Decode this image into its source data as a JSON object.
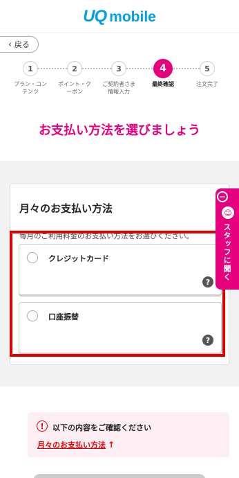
{
  "header": {
    "logo_uq": "UQ",
    "logo_mobile": "mobile",
    "brand_color": "#00a0e9"
  },
  "nav": {
    "back_label": "戻る",
    "back_icon": "chevron-left-icon"
  },
  "stepper": {
    "steps": [
      {
        "number": "1",
        "label": "プラン・コン\nテンツ",
        "state": "done"
      },
      {
        "number": "2",
        "label": "ポイント・ク\nーポン",
        "state": "done"
      },
      {
        "number": "3",
        "label": "ご契約者さま\n情報入力",
        "state": "done"
      },
      {
        "number": "4",
        "label": "最終確認",
        "state": "active"
      },
      {
        "number": "5",
        "label": "注文完了",
        "state": "pending"
      }
    ],
    "accent_color": "#e6007e"
  },
  "page": {
    "title": "お支払い方法を選びましょう"
  },
  "payment": {
    "title": "月々のお支払い方法",
    "description": "毎月のご利用料金のお支払い方法をお選びください。",
    "options": [
      {
        "label": "クレジットカード",
        "help": "?",
        "selected": false
      },
      {
        "label": "口座振替",
        "help": "?",
        "selected": false
      }
    ]
  },
  "staff_tab": {
    "label": "スタッフに聞く",
    "minus": "−",
    "icon": "headset-icon"
  },
  "alert": {
    "icon_glyph": "!",
    "text": "以下の内容をご確認ください",
    "link": "月々のお支払い方法",
    "link_arrow": "↑",
    "color": "#e00000"
  }
}
